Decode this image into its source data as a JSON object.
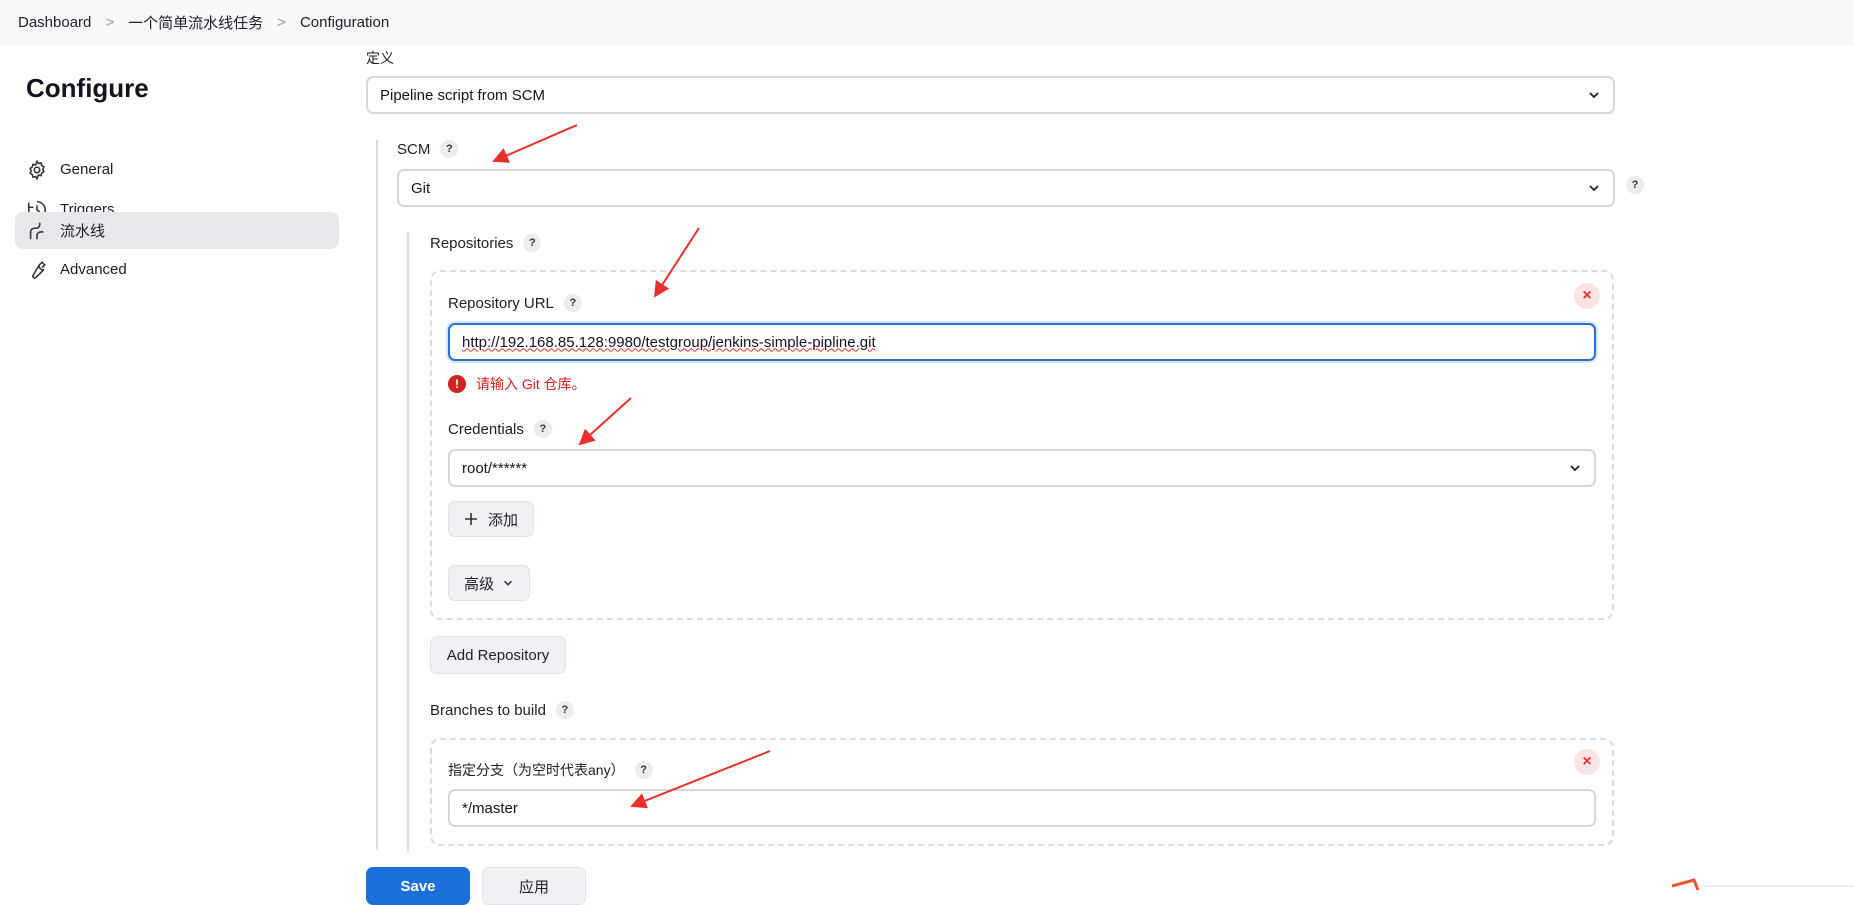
{
  "breadcrumb": {
    "items": [
      "Dashboard",
      "一个简单流水线任务",
      "Configuration"
    ],
    "separator": ">"
  },
  "sidebar": {
    "title": "Configure",
    "items": [
      {
        "label": "General",
        "icon": "gear-icon"
      },
      {
        "label": "Triggers",
        "icon": "clock-icon"
      },
      {
        "label": "流水线",
        "icon": "pipeline-icon",
        "active": true
      },
      {
        "label": "Advanced",
        "icon": "wrench-icon"
      }
    ]
  },
  "definition": {
    "label": "定义",
    "value": "Pipeline script from SCM"
  },
  "scm": {
    "label": "SCM",
    "value": "Git",
    "help": "?"
  },
  "repositories": {
    "label": "Repositories",
    "help": "?",
    "repo_url_label": "Repository URL",
    "repo_url_value": "http://192.168.85.128:9980/testgroup/jenkins-simple-pipline.git",
    "error_text": "请输入 Git 仓库。",
    "credentials_label": "Credentials",
    "credentials_value": "root/******",
    "add_label": "添加",
    "advanced_label": "高级",
    "add_repository_label": "Add Repository",
    "close": "×"
  },
  "branches": {
    "label": "Branches to build",
    "help": "?",
    "branch_label": "指定分支（为空时代表any）",
    "branch_value": "*/master",
    "close": "×"
  },
  "footer": {
    "save_label": "Save",
    "apply_label": "应用"
  },
  "colors": {
    "accent": "#1a6fd9",
    "error": "#d32020",
    "annotation_arrow": "#e8312b"
  }
}
